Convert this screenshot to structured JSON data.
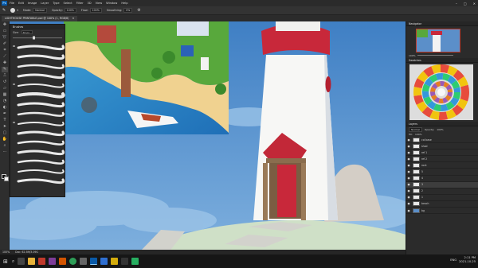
{
  "app": {
    "logo": "Ps"
  },
  "menu": [
    "File",
    "Edit",
    "Image",
    "Layer",
    "Type",
    "Select",
    "Filter",
    "3D",
    "View",
    "Window",
    "Help"
  ],
  "window_controls": {
    "minimize": "–",
    "maximize": "□",
    "close": "✕"
  },
  "options": {
    "mode_label": "Mode:",
    "mode_value": "Normal",
    "opacity_label": "Opacity:",
    "opacity_value": "100%",
    "flow_label": "Flow:",
    "flow_value": "100%",
    "smoothing_label": "Smoothing:",
    "smoothing_value": "0%"
  },
  "document": {
    "tab_title": "LIGHTHOUSE PRINTABLE.psd @ 100% (1, RGB/8)"
  },
  "brushes_panel": {
    "title": "Brushes",
    "size_label": "Size:",
    "size_value": "40 px"
  },
  "navigator": {
    "title": "Navigator",
    "zoom": "100%"
  },
  "swatches": {
    "title": "Swatches"
  },
  "layers_panel": {
    "title": "Layers",
    "blend_mode": "Normal",
    "opacity_label": "Opacity:",
    "opacity_value": "100%",
    "fill_label": "Fill:",
    "fill_value": "100%",
    "layers": [
      {
        "name": "col base"
      },
      {
        "name": "shad"
      },
      {
        "name": "ref 1"
      },
      {
        "name": "ref 2"
      },
      {
        "name": "rock"
      },
      {
        "name": "5"
      },
      {
        "name": "4"
      },
      {
        "name": "3"
      },
      {
        "name": "2"
      },
      {
        "name": "1"
      },
      {
        "name": "beach"
      },
      {
        "name": "bg"
      }
    ]
  },
  "status": {
    "zoom": "100%",
    "doc": "Doc: 62.5M/3.09G"
  },
  "taskbar": {
    "time": "2:11 PM",
    "date": "2021-10-25",
    "lang": "ENG"
  },
  "colors": {
    "sky": "#4d88c6",
    "lighthouse_red": "#c8283a",
    "lighthouse_white": "#f7f7f5",
    "ps_blue": "#0a5aa8"
  }
}
